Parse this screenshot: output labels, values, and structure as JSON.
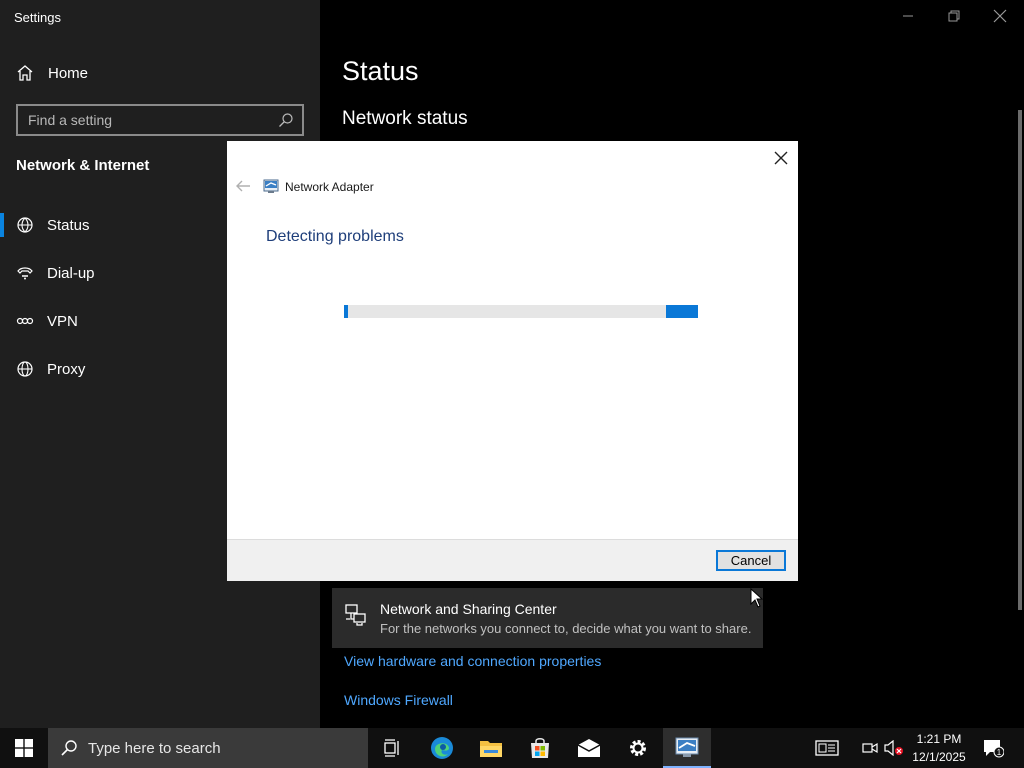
{
  "settings": {
    "app_title": "Settings",
    "home_label": "Home",
    "search_placeholder": "Find a setting",
    "section_title": "Network & Internet",
    "nav_items": [
      {
        "label": "Status",
        "icon": "globe-status-icon",
        "active": true
      },
      {
        "label": "Dial-up",
        "icon": "dialup-icon",
        "active": false
      },
      {
        "label": "VPN",
        "icon": "vpn-icon",
        "active": false
      },
      {
        "label": "Proxy",
        "icon": "globe-icon",
        "active": false
      }
    ],
    "content_title": "Status",
    "content_subtitle": "Network status",
    "sharing_center": {
      "title": "Network and Sharing Center",
      "description": "For the networks you connect to, decide what you want to share."
    },
    "links": {
      "hardware": "View hardware and connection properties",
      "firewall": "Windows Firewall"
    }
  },
  "dialog": {
    "app_name": "Network Adapter",
    "heading": "Detecting problems",
    "cancel_label": "Cancel",
    "progress_fraction": 0.09
  },
  "taskbar": {
    "search_placeholder": "Type here to search",
    "time": "1:21 PM",
    "date": "12/1/2025",
    "notification_count": "1"
  },
  "colors": {
    "accent": "#0a78d7",
    "link": "#4fa8ff",
    "dialog_heading": "#1e3e7a"
  }
}
